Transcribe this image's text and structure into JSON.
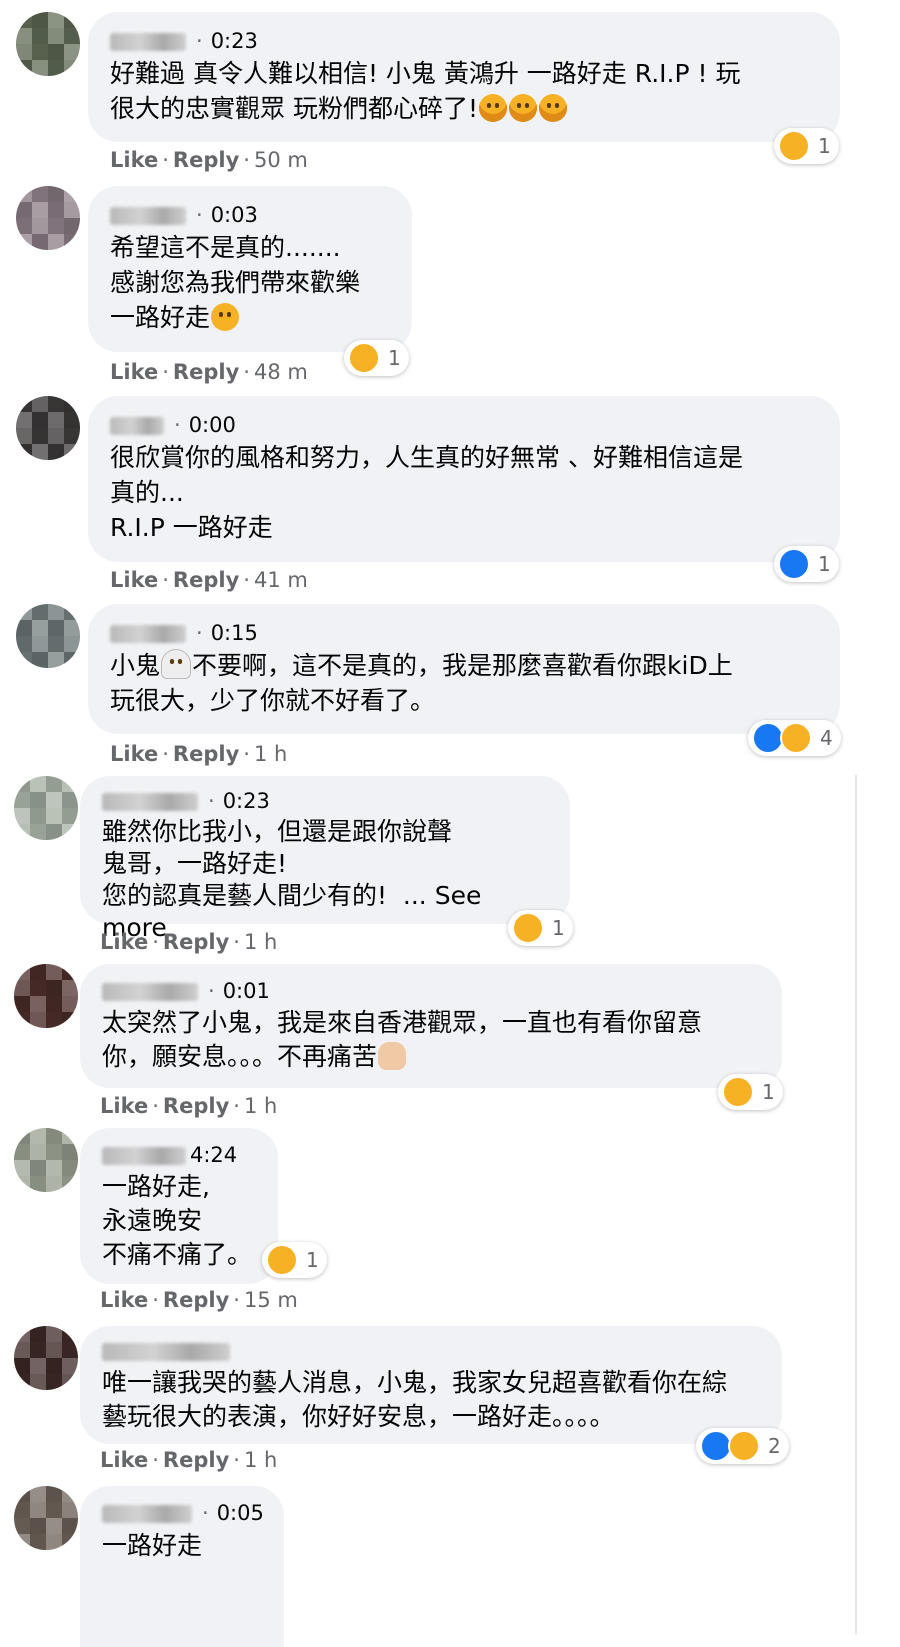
{
  "comments": [
    {
      "time": "0:23",
      "text": "好難過 真令人難以相信! 小鬼 黃鴻升 一路好走 R.I.P ! 玩\n很大的忠實觀眾 玩粉們都心碎了!",
      "trailing_emojis": [
        "cry-icon",
        "cry-icon",
        "cry-icon"
      ],
      "like_label": "Like",
      "reply_label": "Reply",
      "age": "50 m",
      "reactions": [
        "sad"
      ],
      "reaction_count": "1"
    },
    {
      "time": "0:03",
      "text": "希望這不是真的.......\n感謝您為我們帶來歡樂\n一路好走",
      "trailing_emojis": [
        "sad-tear-icon"
      ],
      "like_label": "Like",
      "reply_label": "Reply",
      "age": "48 m",
      "reactions": [
        "sad"
      ],
      "reaction_count": "1"
    },
    {
      "time": "0:00",
      "text": "很欣賞你的風格和努力，人生真的好無常 、好難相信這是\n真的...\nR.I.P 一路好走",
      "trailing_emojis": [],
      "like_label": "Like",
      "reply_label": "Reply",
      "age": "41 m",
      "reactions": [
        "like"
      ],
      "reaction_count": "1"
    },
    {
      "time": "0:15",
      "text_before": "小鬼",
      "text": "不要啊，這不是真的，我是那麼喜歡看你跟kiD上\n玩很大，少了你就不好看了。",
      "trailing_emojis": [],
      "like_label": "Like",
      "reply_label": "Reply",
      "age": "1 h",
      "reactions": [
        "like",
        "sad"
      ],
      "reaction_count": "4"
    },
    {
      "time": "0:23",
      "text": "雖然你比我小，但還是跟你說聲\n鬼哥，一路好走!\n您的認真是藝人間少有的!  ...",
      "see_more": "See more",
      "trailing_emojis": [],
      "like_label": "Like",
      "reply_label": "Reply",
      "age": "1 h",
      "reactions": [
        "sad"
      ],
      "reaction_count": "1"
    },
    {
      "time": "0:01",
      "text": "太突然了小鬼，我是來自香港觀眾，一直也有看你留意\n你，願安息。。。不再痛苦",
      "trailing_emojis": [
        "folded-hands-icon"
      ],
      "like_label": "Like",
      "reply_label": "Reply",
      "age": "1 h",
      "reactions": [
        "sad"
      ],
      "reaction_count": "1"
    },
    {
      "time": "4:24",
      "text": "一路好走,\n永遠晚安\n不痛不痛了。",
      "trailing_emojis": [],
      "like_label": "Like",
      "reply_label": "Reply",
      "age": "15 m",
      "reactions": [
        "sad"
      ],
      "reaction_count": "1"
    },
    {
      "time": "",
      "text": "唯一讓我哭的藝人消息，小鬼，我家女兒超喜歡看你在綜\n藝玩很大的表演，你好好安息，一路好走。。。。",
      "trailing_emojis": [],
      "like_label": "Like",
      "reply_label": "Reply",
      "age": "1 h",
      "reactions": [
        "like",
        "sad"
      ],
      "reaction_count": "2"
    },
    {
      "time": "0:05",
      "text": "一路好走",
      "trailing_emojis": [],
      "like_label": "",
      "reply_label": "",
      "age": "",
      "reactions": [],
      "reaction_count": ""
    }
  ]
}
